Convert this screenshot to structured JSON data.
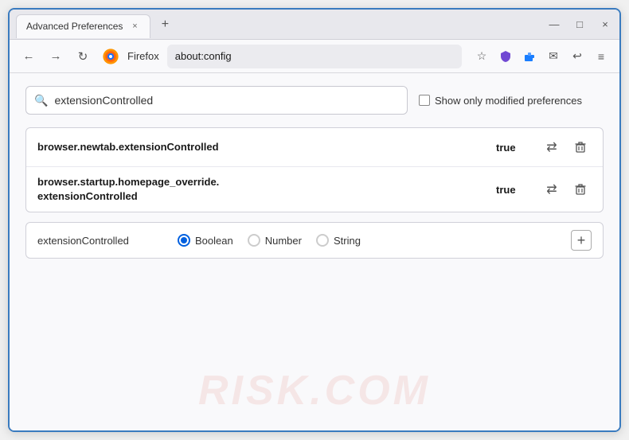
{
  "browser": {
    "tab_title": "Advanced Preferences",
    "tab_close": "×",
    "new_tab": "+",
    "controls": {
      "minimize": "—",
      "maximize": "□",
      "close": "×"
    },
    "nav": {
      "back": "←",
      "forward": "→",
      "reload": "↻",
      "firefox_label": "Firefox",
      "url": "about:config",
      "icons": [
        "☆",
        "🛡",
        "🧩",
        "✉",
        "↩",
        "≡"
      ]
    }
  },
  "search": {
    "placeholder": "extensionControlled",
    "value": "extensionControlled",
    "show_modified_label": "Show only modified preferences"
  },
  "results": [
    {
      "name": "browser.newtab.extensionControlled",
      "value": "true"
    },
    {
      "name_line1": "browser.startup.homepage_override.",
      "name_line2": "extensionControlled",
      "value": "true"
    }
  ],
  "add_preference": {
    "name": "extensionControlled",
    "types": [
      "Boolean",
      "Number",
      "String"
    ],
    "selected_type": "Boolean",
    "add_label": "+"
  },
  "watermark": "RISK.COM",
  "icons": {
    "search": "🔍",
    "swap": "⇄",
    "delete": "🗑",
    "add": "+"
  }
}
